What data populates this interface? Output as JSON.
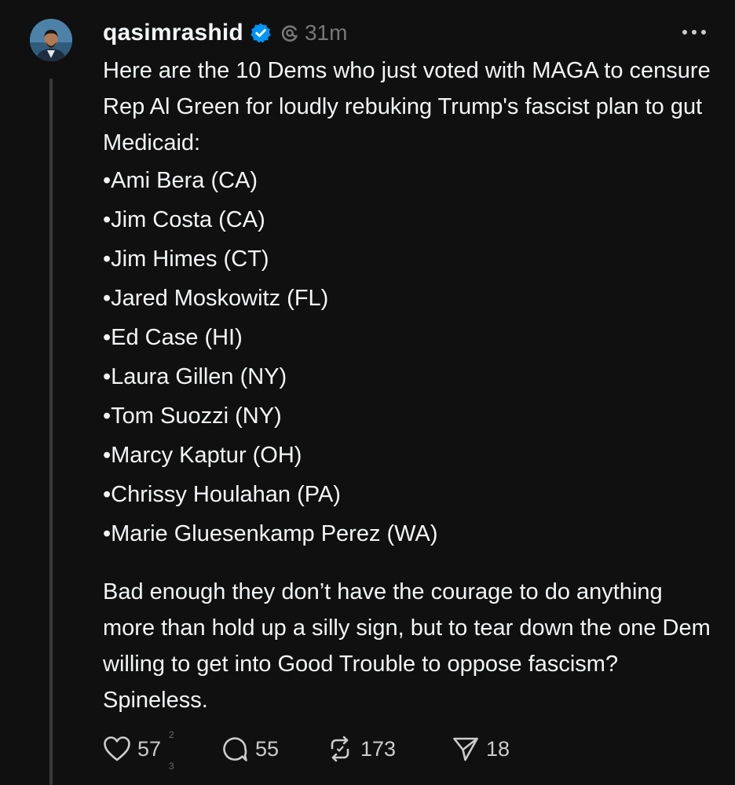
{
  "post": {
    "username": "qasimrashid",
    "time": "31m",
    "intro": "Here are the 10 Dems who just voted with MAGA to censure Rep Al Green for loudly rebuking Trump's fascist plan to gut Medicaid:",
    "list": [
      "•Ami Bera (CA)",
      "•Jim Costa (CA)",
      "•Jim Himes (CT)",
      "•Jared Moskowitz (FL)",
      "•Ed Case (HI)",
      "•Laura Gillen (NY)",
      "•Tom Suozzi (NY)",
      "•Marcy Kaptur (OH)",
      "•Chrissy Houlahan (PA)",
      "•Marie Gluesenkamp Perez (WA)"
    ],
    "closing": "Bad enough they don’t have the courage to do anything more than hold up a silly sign, but to tear down the one Dem willing to get into Good Trouble to oppose fascism? Spineless."
  },
  "actions": {
    "likes": "57",
    "like_superscript": "2",
    "like_subscript": "3",
    "comments": "55",
    "reposts": "173",
    "shares": "18"
  },
  "icons": {
    "verified": "verified-badge-icon",
    "threads": "threads-logo-icon",
    "more": "more-options-icon",
    "like": "heart-icon",
    "comment": "comment-bubble-icon",
    "repost": "repost-icon",
    "share": "send-icon"
  },
  "colors": {
    "background": "#101010",
    "text": "#f3f5f7",
    "muted": "#777777",
    "verified": "#0095f6"
  }
}
